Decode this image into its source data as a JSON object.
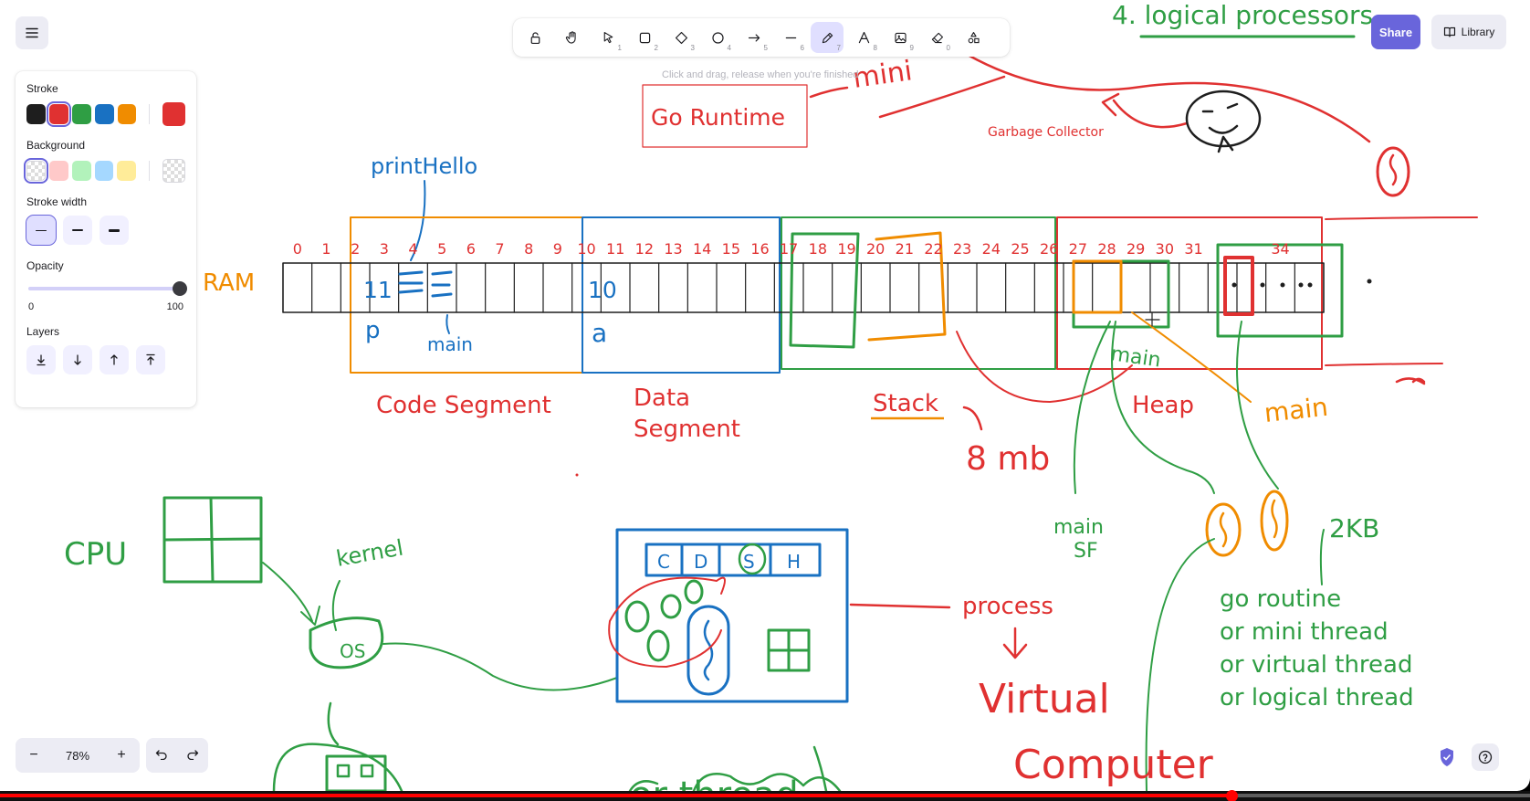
{
  "app": {
    "zoom": "78%",
    "hint": "Click and drag, release when you're finished",
    "share_label": "Share",
    "library_label": "Library"
  },
  "toolbar": {
    "tools": [
      {
        "name": "lock",
        "num": ""
      },
      {
        "name": "hand",
        "num": ""
      },
      {
        "name": "selection",
        "num": "1"
      },
      {
        "name": "rectangle",
        "num": "2"
      },
      {
        "name": "diamond",
        "num": "3"
      },
      {
        "name": "ellipse",
        "num": "4"
      },
      {
        "name": "arrow",
        "num": "5"
      },
      {
        "name": "line",
        "num": "6"
      },
      {
        "name": "draw",
        "num": "7",
        "active": true
      },
      {
        "name": "text",
        "num": "8"
      },
      {
        "name": "image",
        "num": "9"
      },
      {
        "name": "eraser",
        "num": "0"
      },
      {
        "name": "more-tools",
        "num": ""
      }
    ]
  },
  "properties": {
    "stroke_label": "Stroke",
    "stroke_colors": [
      "#1e1e1e",
      "#e03131",
      "#2f9e44",
      "#1971c2",
      "#f08c00"
    ],
    "stroke_current": "#e03131",
    "background_label": "Background",
    "background_colors": [
      "transparent",
      "#ffc9c9",
      "#b2f2bb",
      "#a5d8ff",
      "#ffec99"
    ],
    "stroke_width_label": "Stroke width",
    "opacity_label": "Opacity",
    "opacity_min": "0",
    "opacity_max": "100",
    "opacity_value": 100,
    "layers_label": "Layers"
  },
  "colors": {
    "accent": "#6965db",
    "ink_red": "#e03131",
    "ink_green": "#2f9e44",
    "ink_blue": "#1971c2",
    "ink_orange": "#f08c00"
  },
  "drawing": {
    "title_logical": "4. logical processors",
    "go_runtime": "Go Runtime",
    "mini": "mini",
    "garbage_collector": "Garbage Collector",
    "print_hello": "printHello",
    "ram": "RAM",
    "ram_indices": [
      "0",
      "1",
      "2",
      "3",
      "4",
      "5",
      "6",
      "7",
      "8",
      "9",
      "10",
      "11",
      "12",
      "13",
      "14",
      "15",
      "16",
      "17",
      "18",
      "19",
      "20",
      "21",
      "22",
      "23",
      "24",
      "25",
      "26",
      "27",
      "28",
      "29",
      "30",
      "31",
      "34"
    ],
    "cell_11": "11",
    "cell_10": "10",
    "label_p": "p",
    "label_a": "a",
    "main_code": "main",
    "code_segment": "Code Segment",
    "data_segment_1": "Data",
    "data_segment_2": "Segment",
    "stack": "Stack",
    "heap": "Heap",
    "stack_size": "8 mb",
    "main_heap_green": "main",
    "main_heap_orange": "main",
    "main_sf_1": "main",
    "main_sf_2": "SF",
    "two_kb": "2KB",
    "cpu": "CPU",
    "kernel": "kernel",
    "os": "OS",
    "process": "process",
    "proc_segments": [
      "C",
      "D",
      "S",
      "H"
    ],
    "virtual": "Virtual",
    "computer": "Computer",
    "goroutine_lines": [
      "go routine",
      "or mini thread",
      "or virtual thread",
      "or logical thread"
    ],
    "bottom_partial": "or thread"
  },
  "video": {
    "progress": 0.805
  }
}
